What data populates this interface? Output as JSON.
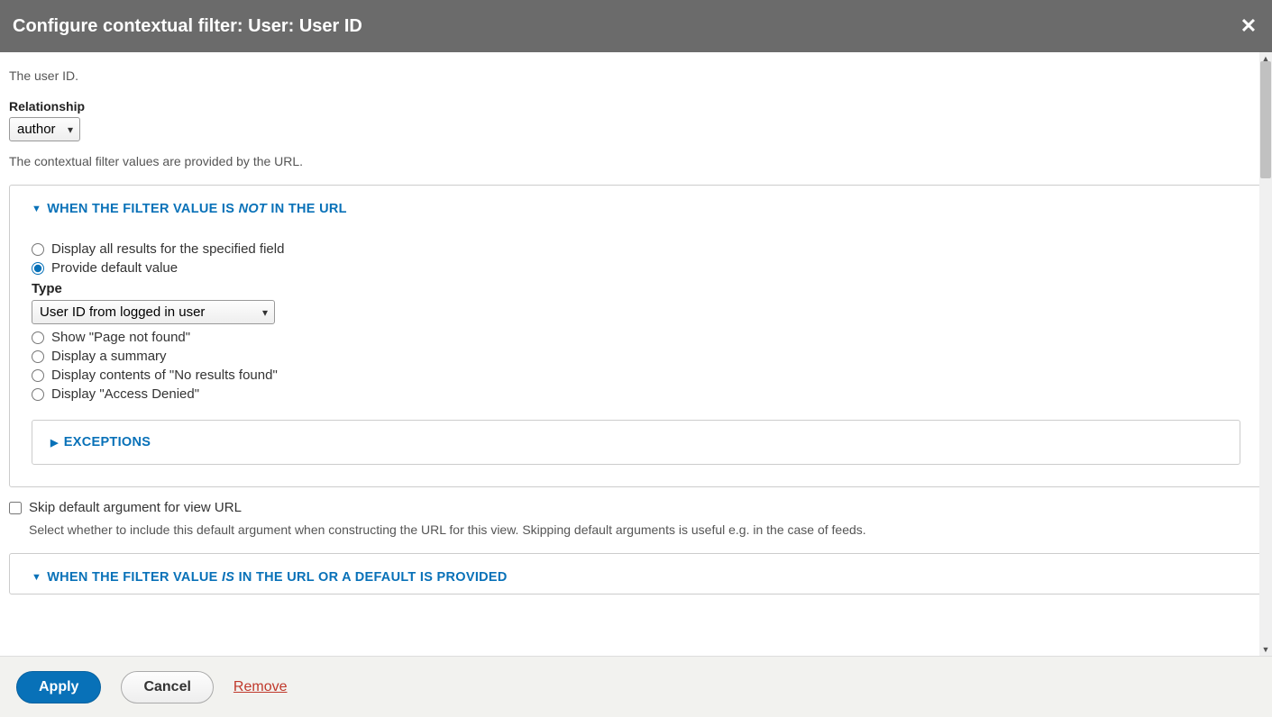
{
  "header": {
    "title": "Configure contextual filter: User: User ID"
  },
  "description": "The user ID.",
  "relationship": {
    "label": "Relationship",
    "selected": "author"
  },
  "help_url": "The contextual filter values are provided by the URL.",
  "section_not_in_url": {
    "legend_prefix": "WHEN THE FILTER VALUE IS ",
    "legend_em": "NOT",
    "legend_suffix": " IN THE URL",
    "options": {
      "display_all": "Display all results for the specified field",
      "provide_default": "Provide default value",
      "page_not_found": "Show \"Page not found\"",
      "summary": "Display a summary",
      "no_results": "Display contents of \"No results found\"",
      "access_denied": "Display \"Access Denied\""
    },
    "type_label": "Type",
    "type_selected": "User ID from logged in user",
    "exceptions_label": "EXCEPTIONS"
  },
  "skip_default": {
    "label": "Skip default argument for view URL",
    "help": "Select whether to include this default argument when constructing the URL for this view. Skipping default arguments is useful e.g. in the case of feeds."
  },
  "section_in_url": {
    "legend_prefix": "WHEN THE FILTER VALUE ",
    "legend_em": "IS",
    "legend_suffix": " IN THE URL OR A DEFAULT IS PROVIDED"
  },
  "footer": {
    "apply": "Apply",
    "cancel": "Cancel",
    "remove": "Remove"
  }
}
